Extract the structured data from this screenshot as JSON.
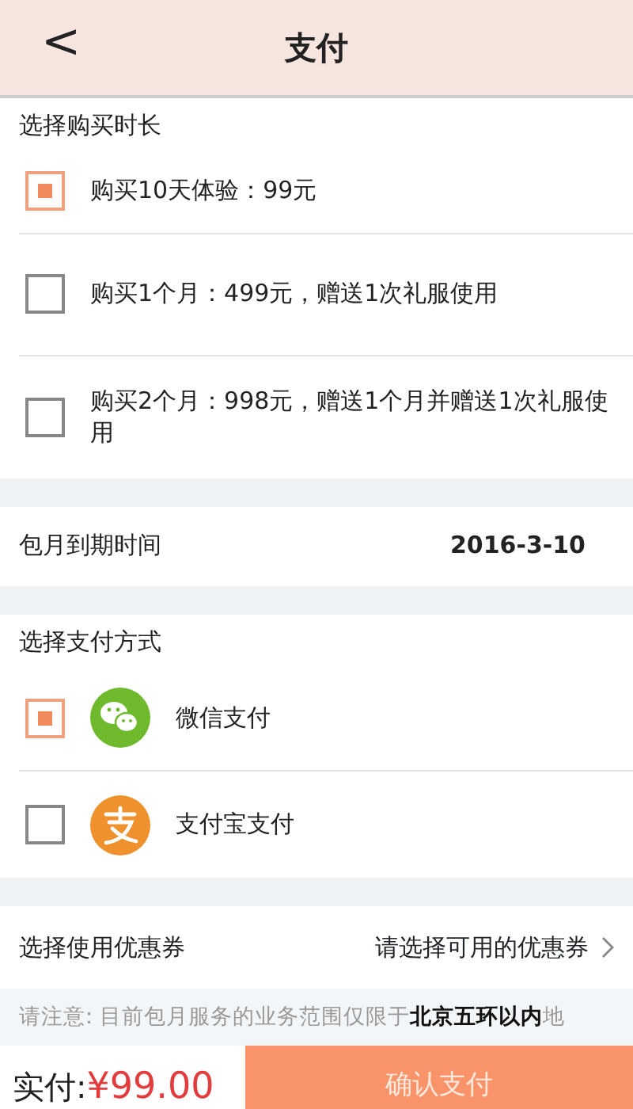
{
  "header": {
    "back": "<",
    "title": "支付"
  },
  "duration": {
    "title": "选择购买时长",
    "options": [
      {
        "label": "购买10天体验：99元",
        "selected": true
      },
      {
        "label": "购买1个月：499元，赠送1次礼服使用",
        "selected": false
      },
      {
        "label": "购买2个月：998元，赠送1个月并赠送1次礼服使用",
        "selected": false
      }
    ]
  },
  "expiry": {
    "label": "包月到期时间",
    "value": "2016-3-10"
  },
  "payment": {
    "title": "选择支付方式",
    "methods": [
      {
        "kind": "wechat",
        "label": "微信支付",
        "selected": true
      },
      {
        "kind": "alipay",
        "label": "支付宝支付",
        "selected": false
      }
    ]
  },
  "coupon": {
    "label": "选择使用优惠券",
    "value": "请选择可用的优惠券"
  },
  "notice": "请注意: 目前包月服务的业务范围仅限于**北京五环以内**地",
  "footer": {
    "label": "实付:",
    "amount": "¥99.00",
    "button": "确认支付"
  }
}
